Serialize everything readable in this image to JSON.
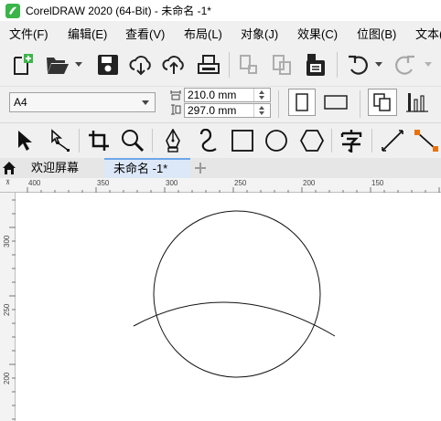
{
  "window": {
    "title": "CorelDRAW 2020 (64-Bit) - 未命名 -1*"
  },
  "menu": {
    "items": [
      {
        "label": "文件(F)"
      },
      {
        "label": "编辑(E)"
      },
      {
        "label": "查看(V)"
      },
      {
        "label": "布局(L)"
      },
      {
        "label": "对象(J)"
      },
      {
        "label": "效果(C)"
      },
      {
        "label": "位图(B)"
      },
      {
        "label": "文本("
      }
    ]
  },
  "property_bar": {
    "paper_size": "A4",
    "width": "210.0 mm",
    "height": "297.0 mm"
  },
  "tabs": [
    {
      "label": "欢迎屏幕"
    },
    {
      "label": "未命名 -1*"
    }
  ],
  "rulers": {
    "top": [
      "400",
      "350",
      "300",
      "250",
      "200",
      "150"
    ],
    "left": [
      "300",
      "250",
      "200"
    ]
  },
  "colors": {
    "accent": "#6fa6e8",
    "ui_background": "#f0f0f0",
    "canvas": "#ffffff"
  }
}
